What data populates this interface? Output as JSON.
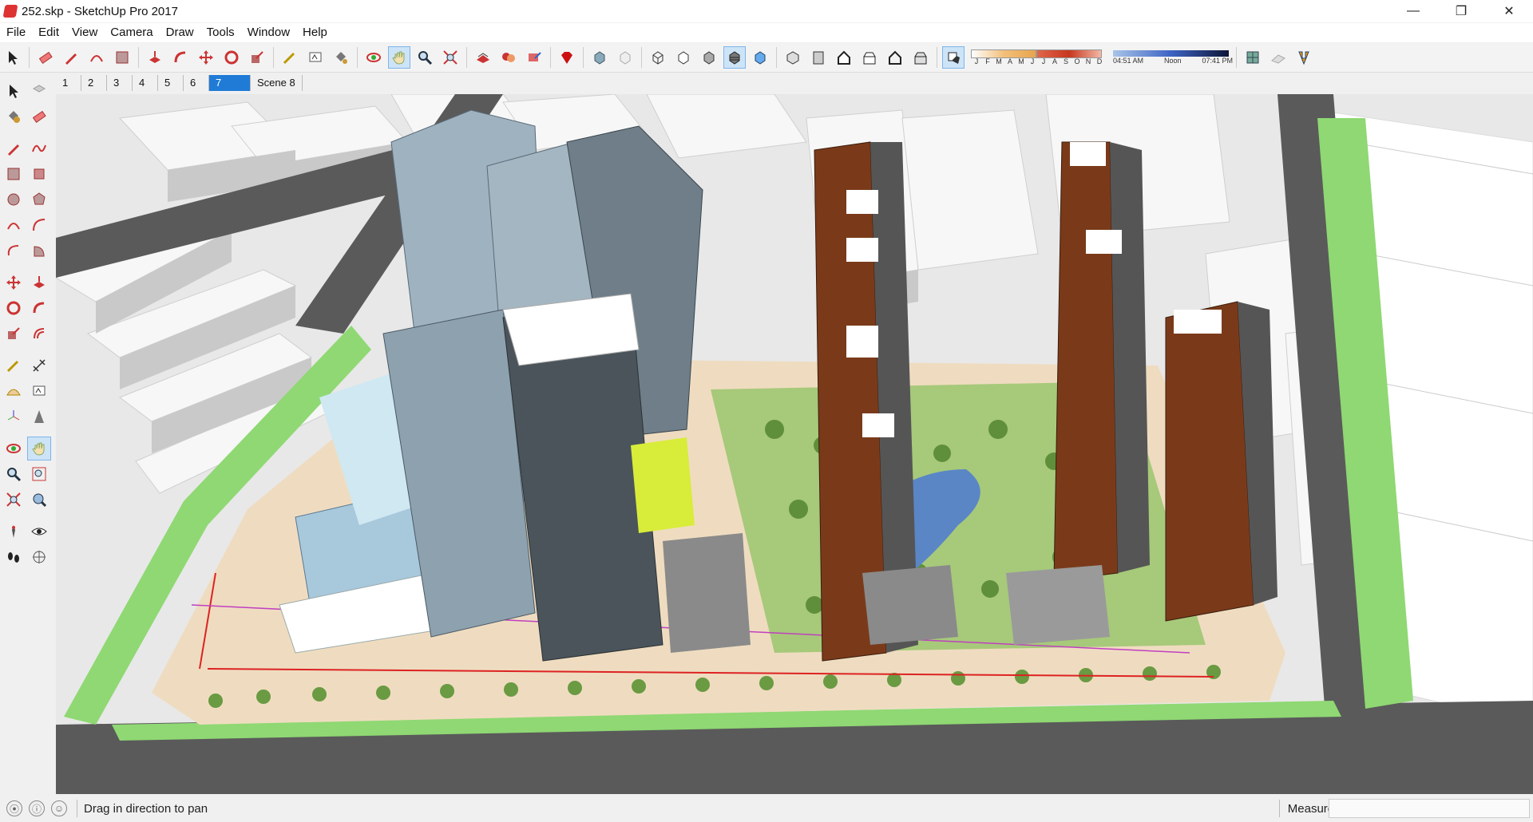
{
  "window": {
    "title": "252.skp - SketchUp Pro 2017",
    "controls": {
      "minimize": "—",
      "maximize": "❐",
      "close": "✕"
    }
  },
  "menu": [
    "File",
    "Edit",
    "View",
    "Camera",
    "Draw",
    "Tools",
    "Window",
    "Help"
  ],
  "shadows": {
    "months": [
      "J",
      "F",
      "M",
      "A",
      "M",
      "J",
      "J",
      "A",
      "S",
      "O",
      "N",
      "D"
    ],
    "sunrise": "04:51 AM",
    "noon": "Noon",
    "sunset": "07:41 PM"
  },
  "scenes": {
    "tabs": [
      "1",
      "2",
      "3",
      "4",
      "5",
      "6",
      "7",
      "Scene 8"
    ],
    "active_index": 6
  },
  "status": {
    "hint": "Drag in direction to pan",
    "measurements_label": "Measurements",
    "measurements_value": ""
  },
  "colors": {
    "accent": "#1f7bd6",
    "active_tool_bg": "#cde4f7",
    "road": "#5a5a5a",
    "grass": "#8fd873",
    "tower_brown": "#7a3a1a",
    "glass": "#9fb2c0"
  }
}
